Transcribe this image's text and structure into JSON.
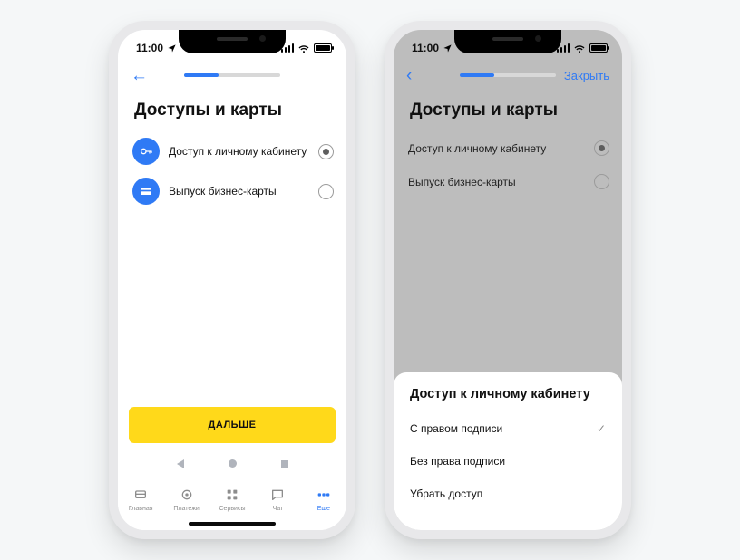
{
  "status": {
    "time": "11:00"
  },
  "screen1": {
    "title": "Доступы и карты",
    "options": [
      {
        "label": "Доступ к личному кабинету",
        "selected": true
      },
      {
        "label": "Выпуск бизнес-карты",
        "selected": false
      }
    ],
    "primary_button": "ДАЛЬШЕ",
    "tabs": [
      {
        "label": "Главная"
      },
      {
        "label": "Платежи"
      },
      {
        "label": "Сервисы"
      },
      {
        "label": "Чат"
      },
      {
        "label": "Еще"
      }
    ],
    "progress": 0.36
  },
  "screen2": {
    "title": "Доступы и карты",
    "close": "Закрыть",
    "options": [
      {
        "label": "Доступ к личному кабинету",
        "selected": true
      },
      {
        "label": "Выпуск бизнес-карты",
        "selected": false
      }
    ],
    "sheet": {
      "title": "Доступ к личному кабинету",
      "items": [
        {
          "label": "С правом подписи",
          "checked": true
        },
        {
          "label": "Без права подписи",
          "checked": false
        },
        {
          "label": "Убрать доступ",
          "checked": false
        }
      ]
    },
    "progress": 0.36
  }
}
